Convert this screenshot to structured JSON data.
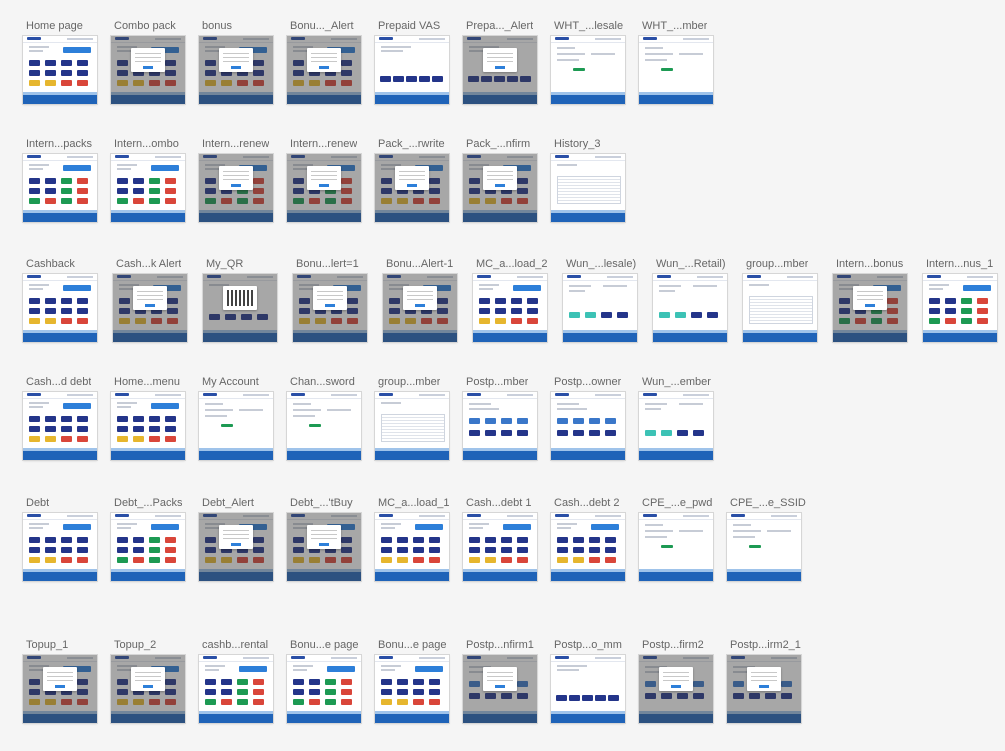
{
  "page": {
    "background": "#f5f5f5"
  },
  "rows": [
    {
      "boards": [
        {
          "label": "Home page",
          "variant": "home",
          "overlay": false
        },
        {
          "label": "Combo pack",
          "variant": "home",
          "overlay": true
        },
        {
          "label": "bonus",
          "variant": "home",
          "overlay": true
        },
        {
          "label": "Bonu..._Alert",
          "variant": "home",
          "overlay": true
        },
        {
          "label": "Prepaid VAS",
          "variant": "vas",
          "overlay": false
        },
        {
          "label": "Prepa..._Alert",
          "variant": "vas",
          "overlay": true
        },
        {
          "label": "WHT_...lesale",
          "variant": "form",
          "overlay": false
        },
        {
          "label": "WHT_...mber",
          "variant": "form",
          "overlay": false
        }
      ]
    },
    {
      "boards": [
        {
          "label": "Intern...packs",
          "variant": "packs",
          "overlay": false
        },
        {
          "label": "Intern...ombo",
          "variant": "packs",
          "overlay": false
        },
        {
          "label": "Intern...renew",
          "variant": "packs",
          "overlay": true
        },
        {
          "label": "Intern...renew",
          "variant": "packs",
          "overlay": true
        },
        {
          "label": "Pack_...rwrite",
          "variant": "home",
          "overlay": true
        },
        {
          "label": "Pack_...nfirm",
          "variant": "home",
          "overlay": true
        },
        {
          "label": "History_3",
          "variant": "table",
          "overlay": false
        }
      ]
    },
    {
      "boards": [
        {
          "label": "Cashback",
          "variant": "home",
          "overlay": false
        },
        {
          "label": "Cash...k Alert",
          "variant": "home",
          "overlay": true
        },
        {
          "label": "My_QR",
          "variant": "qr",
          "overlay": true
        },
        {
          "label": "Bonu...lert=1",
          "variant": "home",
          "overlay": true
        },
        {
          "label": "Bonu...Alert-1",
          "variant": "home",
          "overlay": true
        },
        {
          "label": "MC_a...load_2",
          "variant": "home",
          "overlay": false
        },
        {
          "label": "Wun_...lesale)",
          "variant": "wun",
          "overlay": false
        },
        {
          "label": "Wun_...Retail)",
          "variant": "wun",
          "overlay": false
        },
        {
          "label": "group...mber",
          "variant": "table",
          "overlay": false
        },
        {
          "label": "Intern...bonus",
          "variant": "packs",
          "overlay": true
        },
        {
          "label": "Intern...nus_1",
          "variant": "packs",
          "overlay": false
        }
      ]
    },
    {
      "boards": [
        {
          "label": "Cash...d debt",
          "variant": "home",
          "overlay": false
        },
        {
          "label": "Home...menu",
          "variant": "home",
          "overlay": false
        },
        {
          "label": "My Account",
          "variant": "form",
          "overlay": false
        },
        {
          "label": "Chan...sword",
          "variant": "form",
          "overlay": false
        },
        {
          "label": "group...mber",
          "variant": "table",
          "overlay": false
        },
        {
          "label": "Postp...mber",
          "variant": "post",
          "overlay": false
        },
        {
          "label": "Postp...owner",
          "variant": "post",
          "overlay": false
        },
        {
          "label": "Wun_...ember",
          "variant": "wun",
          "overlay": false
        }
      ]
    },
    {
      "boards": [
        {
          "label": "Debt",
          "variant": "home",
          "overlay": false
        },
        {
          "label": "Debt_...Packs",
          "variant": "packs",
          "overlay": false
        },
        {
          "label": "Debt_Alert",
          "variant": "home",
          "overlay": true
        },
        {
          "label": "Debt_...'tBuy",
          "variant": "home",
          "overlay": true
        },
        {
          "label": "MC_a...load_1",
          "variant": "home",
          "overlay": false
        },
        {
          "label": "Cash...debt 1",
          "variant": "home",
          "overlay": false
        },
        {
          "label": "Cash...debt 2",
          "variant": "home",
          "overlay": false
        },
        {
          "label": "CPE_...e_pwd",
          "variant": "form",
          "overlay": false
        },
        {
          "label": "CPE_...e_SSID",
          "variant": "form",
          "overlay": false
        }
      ]
    },
    {
      "boards": [
        {
          "label": "Topup_1",
          "variant": "home",
          "overlay": true
        },
        {
          "label": "Topup_2",
          "variant": "home",
          "overlay": true
        },
        {
          "label": "cashb...rental",
          "variant": "packs",
          "overlay": false
        },
        {
          "label": "Bonu...e page",
          "variant": "packs",
          "overlay": false
        },
        {
          "label": "Bonu...e page",
          "variant": "home",
          "overlay": false
        },
        {
          "label": "Postp...nfirm1",
          "variant": "post",
          "overlay": true
        },
        {
          "label": "Postp...o_mm",
          "variant": "vas",
          "overlay": false
        },
        {
          "label": "Postp...firm2",
          "variant": "post",
          "overlay": true
        },
        {
          "label": "Postp...irm2_1",
          "variant": "post",
          "overlay": true
        }
      ]
    }
  ],
  "colors": {
    "brand_blue": "#1f63b8",
    "button_blue": "#2d7fd9",
    "card_navy": "#24358a",
    "card_green": "#1d9a53",
    "card_red": "#d9463a",
    "card_yellow": "#e6b62e",
    "card_teal": "#3cc2b5",
    "overlay": "#595959"
  }
}
